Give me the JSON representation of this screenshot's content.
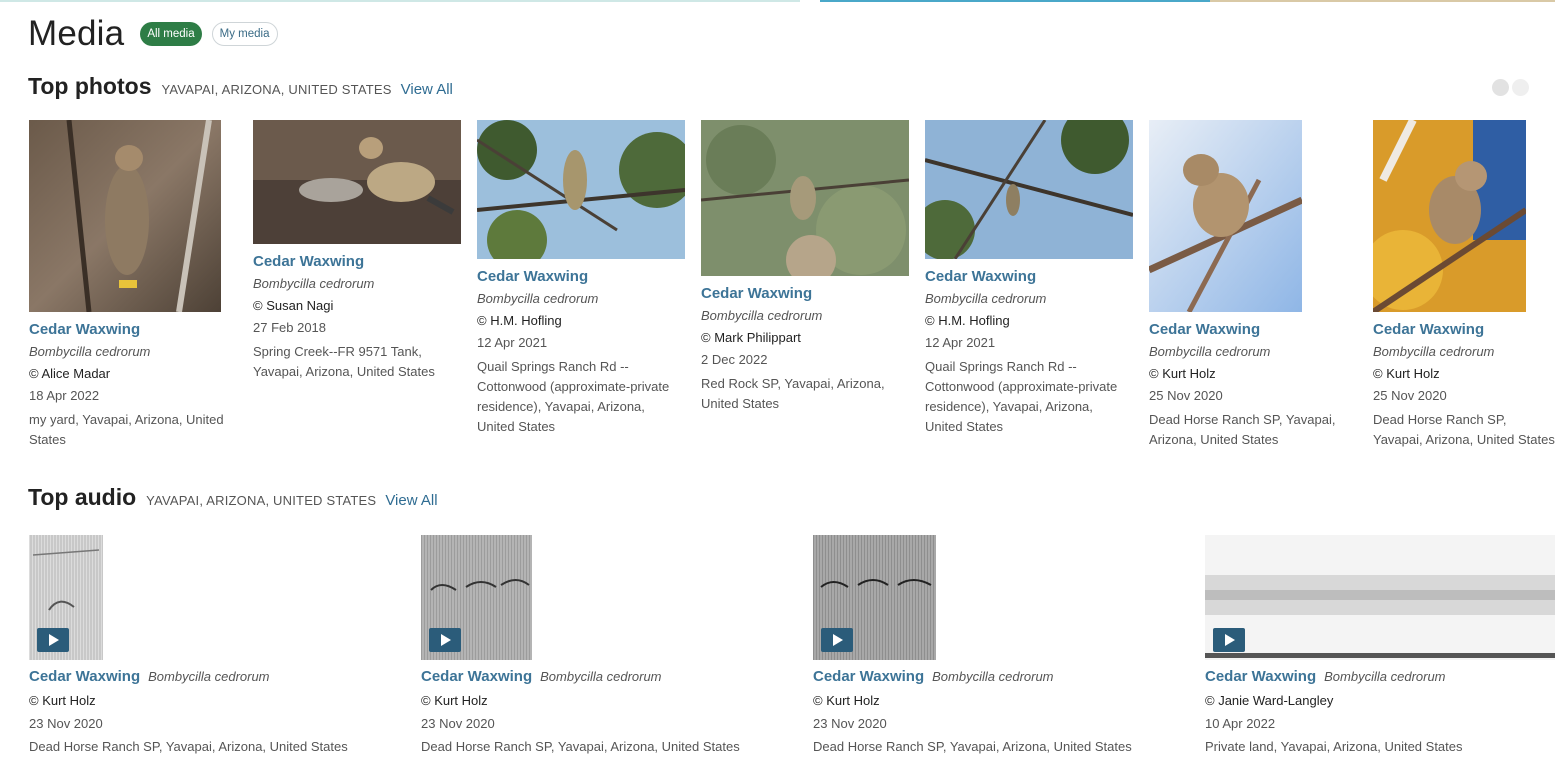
{
  "page": {
    "title": "Media",
    "filters": [
      {
        "label": "All media",
        "active": true
      },
      {
        "label": "My media",
        "active": false
      }
    ]
  },
  "top_photos": {
    "title": "Top photos",
    "location": "YAVAPAI, ARIZONA, UNITED STATES",
    "view_all": "View All",
    "items": [
      {
        "name": "Cedar Waxwing",
        "sci": "Bombycilla cedrorum",
        "credit": "© Alice Madar",
        "date": "18 Apr 2022",
        "location": "my yard, Yavapai, Arizona, United States"
      },
      {
        "name": "Cedar Waxwing",
        "sci": "Bombycilla cedrorum",
        "credit": "© Susan Nagi",
        "date": "27 Feb 2018",
        "location": "Spring Creek--FR 9571 Tank, Yavapai, Arizona, United States"
      },
      {
        "name": "Cedar Waxwing",
        "sci": "Bombycilla cedrorum",
        "credit": "© H.M. Hofling",
        "date": "12 Apr 2021",
        "location": "Quail Springs Ranch Rd -- Cottonwood (approximate-private residence), Yavapai, Arizona, United States"
      },
      {
        "name": "Cedar Waxwing",
        "sci": "Bombycilla cedrorum",
        "credit": "© Mark Philippart",
        "date": "2 Dec 2022",
        "location": "Red Rock SP, Yavapai, Arizona, United States"
      },
      {
        "name": "Cedar Waxwing",
        "sci": "Bombycilla cedrorum",
        "credit": "© H.M. Hofling",
        "date": "12 Apr 2021",
        "location": "Quail Springs Ranch Rd -- Cottonwood (approximate-private residence), Yavapai, Arizona, United States"
      },
      {
        "name": "Cedar Waxwing",
        "sci": "Bombycilla cedrorum",
        "credit": "© Kurt Holz",
        "date": "25 Nov 2020",
        "location": "Dead Horse Ranch SP, Yavapai, Arizona, United States"
      },
      {
        "name": "Cedar Waxwing",
        "sci": "Bombycilla cedrorum",
        "credit": "© Kurt Holz",
        "date": "25 Nov 2020",
        "location": "Dead Horse Ranch SP, Yavapai, Arizona, United States"
      }
    ]
  },
  "top_audio": {
    "title": "Top audio",
    "location": "YAVAPAI, ARIZONA, UNITED STATES",
    "view_all": "View All",
    "items": [
      {
        "name": "Cedar Waxwing",
        "sci": "Bombycilla cedrorum",
        "credit": "© Kurt Holz",
        "date": "23 Nov 2020",
        "location": "Dead Horse Ranch SP, Yavapai, Arizona, United States"
      },
      {
        "name": "Cedar Waxwing",
        "sci": "Bombycilla cedrorum",
        "credit": "© Kurt Holz",
        "date": "23 Nov 2020",
        "location": "Dead Horse Ranch SP, Yavapai, Arizona, United States"
      },
      {
        "name": "Cedar Waxwing",
        "sci": "Bombycilla cedrorum",
        "credit": "© Kurt Holz",
        "date": "23 Nov 2020",
        "location": "Dead Horse Ranch SP, Yavapai, Arizona, United States"
      },
      {
        "name": "Cedar Waxwing",
        "sci": "Bombycilla cedrorum",
        "credit": "© Janie Ward-Langley",
        "date": "10 Apr 2022",
        "location": "Private land, Yavapai, Arizona, United States"
      }
    ]
  },
  "colors": {
    "accent_green": "#2e7d46",
    "link_blue": "#2f6c92",
    "species_blue": "#3d7497",
    "play_button": "#2b5c7a"
  },
  "icons": {
    "play": "play-icon",
    "carousel_dot": "carousel-dot"
  }
}
